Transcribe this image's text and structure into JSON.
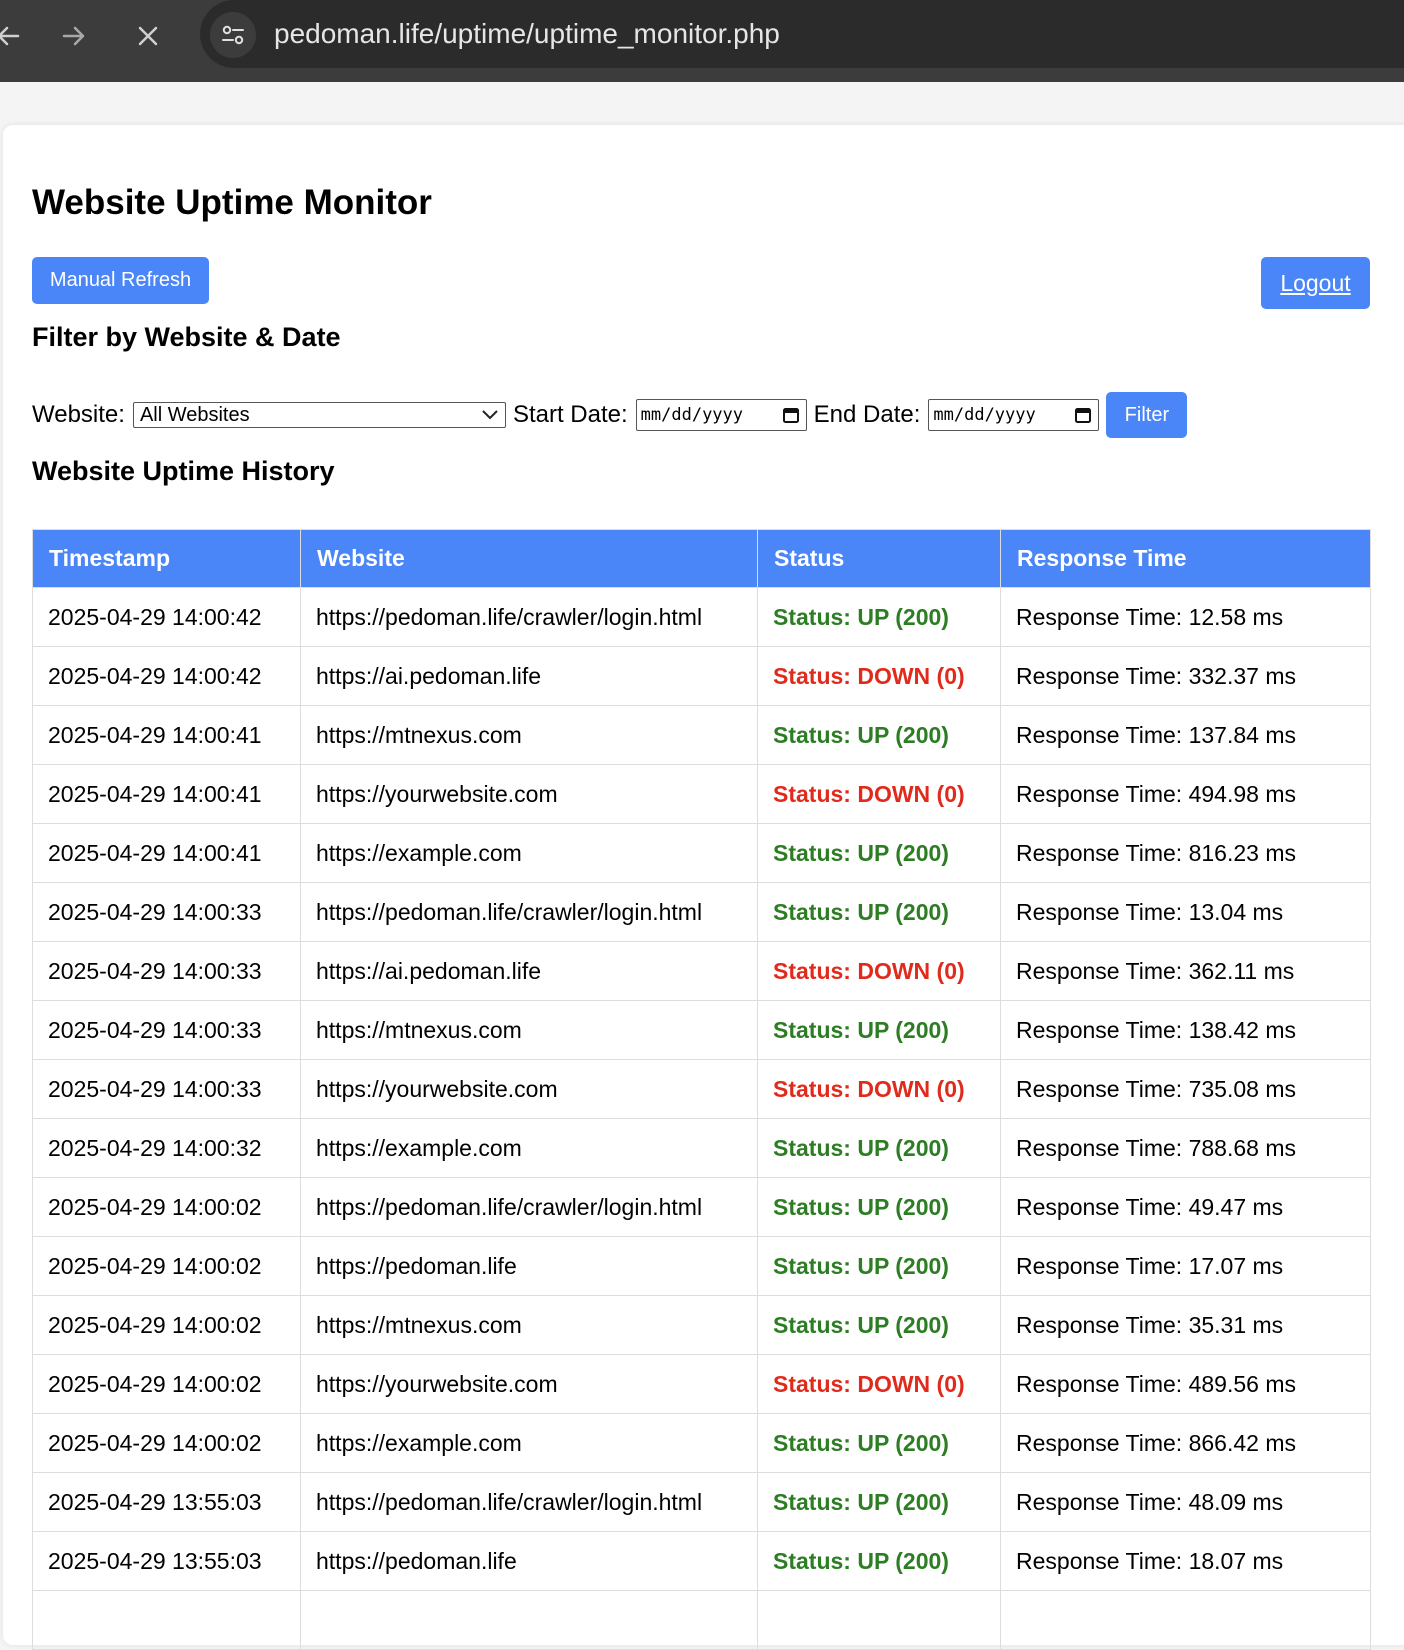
{
  "browser": {
    "url": "pedoman.life/uptime/uptime_monitor.php"
  },
  "page": {
    "title": "Website Uptime Monitor",
    "refresh_label": "Manual Refresh",
    "logout_label": "Logout"
  },
  "filter": {
    "heading": "Filter by Website & Date",
    "website_label": "Website:",
    "website_selected": "All Websites",
    "start_label": "Start Date:",
    "start_placeholder": "mm/dd/yyyy",
    "end_label": "End Date:",
    "end_placeholder": "mm/dd/yyyy",
    "button_label": "Filter"
  },
  "history": {
    "heading": "Website Uptime History",
    "columns": [
      "Timestamp",
      "Website",
      "Status",
      "Response Time"
    ],
    "rows": [
      {
        "timestamp": "2025-04-29 14:00:42",
        "website": "https://pedoman.life/crawler/login.html",
        "status": "Status: UP (200)",
        "state": "up",
        "response": "Response Time: 12.58 ms"
      },
      {
        "timestamp": "2025-04-29 14:00:42",
        "website": "https://ai.pedoman.life",
        "status": "Status: DOWN (0)",
        "state": "down",
        "response": "Response Time: 332.37 ms"
      },
      {
        "timestamp": "2025-04-29 14:00:41",
        "website": "https://mtnexus.com",
        "status": "Status: UP (200)",
        "state": "up",
        "response": "Response Time: 137.84 ms"
      },
      {
        "timestamp": "2025-04-29 14:00:41",
        "website": "https://yourwebsite.com",
        "status": "Status: DOWN (0)",
        "state": "down",
        "response": "Response Time: 494.98 ms"
      },
      {
        "timestamp": "2025-04-29 14:00:41",
        "website": "https://example.com",
        "status": "Status: UP (200)",
        "state": "up",
        "response": "Response Time: 816.23 ms"
      },
      {
        "timestamp": "2025-04-29 14:00:33",
        "website": "https://pedoman.life/crawler/login.html",
        "status": "Status: UP (200)",
        "state": "up",
        "response": "Response Time: 13.04 ms"
      },
      {
        "timestamp": "2025-04-29 14:00:33",
        "website": "https://ai.pedoman.life",
        "status": "Status: DOWN (0)",
        "state": "down",
        "response": "Response Time: 362.11 ms"
      },
      {
        "timestamp": "2025-04-29 14:00:33",
        "website": "https://mtnexus.com",
        "status": "Status: UP (200)",
        "state": "up",
        "response": "Response Time: 138.42 ms"
      },
      {
        "timestamp": "2025-04-29 14:00:33",
        "website": "https://yourwebsite.com",
        "status": "Status: DOWN (0)",
        "state": "down",
        "response": "Response Time: 735.08 ms"
      },
      {
        "timestamp": "2025-04-29 14:00:32",
        "website": "https://example.com",
        "status": "Status: UP (200)",
        "state": "up",
        "response": "Response Time: 788.68 ms"
      },
      {
        "timestamp": "2025-04-29 14:00:02",
        "website": "https://pedoman.life/crawler/login.html",
        "status": "Status: UP (200)",
        "state": "up",
        "response": "Response Time: 49.47 ms"
      },
      {
        "timestamp": "2025-04-29 14:00:02",
        "website": "https://pedoman.life",
        "status": "Status: UP (200)",
        "state": "up",
        "response": "Response Time: 17.07 ms"
      },
      {
        "timestamp": "2025-04-29 14:00:02",
        "website": "https://mtnexus.com",
        "status": "Status: UP (200)",
        "state": "up",
        "response": "Response Time: 35.31 ms"
      },
      {
        "timestamp": "2025-04-29 14:00:02",
        "website": "https://yourwebsite.com",
        "status": "Status: DOWN (0)",
        "state": "down",
        "response": "Response Time: 489.56 ms"
      },
      {
        "timestamp": "2025-04-29 14:00:02",
        "website": "https://example.com",
        "status": "Status: UP (200)",
        "state": "up",
        "response": "Response Time: 866.42 ms"
      },
      {
        "timestamp": "2025-04-29 13:55:03",
        "website": "https://pedoman.life/crawler/login.html",
        "status": "Status: UP (200)",
        "state": "up",
        "response": "Response Time: 48.09 ms"
      },
      {
        "timestamp": "2025-04-29 13:55:03",
        "website": "https://pedoman.life",
        "status": "Status: UP (200)",
        "state": "up",
        "response": "Response Time: 18.07 ms"
      },
      {
        "timestamp": "",
        "website": "",
        "status": "",
        "state": "up",
        "response": ""
      }
    ]
  },
  "colors": {
    "accent": "#4a86f7",
    "status_up": "#2c7d23",
    "status_down": "#e02b1c",
    "browser_chrome": "#3c3c3c"
  },
  "icons": {
    "back": "arrow-left-icon",
    "forward": "arrow-right-icon",
    "stop": "close-icon",
    "site_info": "tune-icon",
    "select_caret": "chevron-down-icon",
    "calendar": "calendar-icon"
  }
}
